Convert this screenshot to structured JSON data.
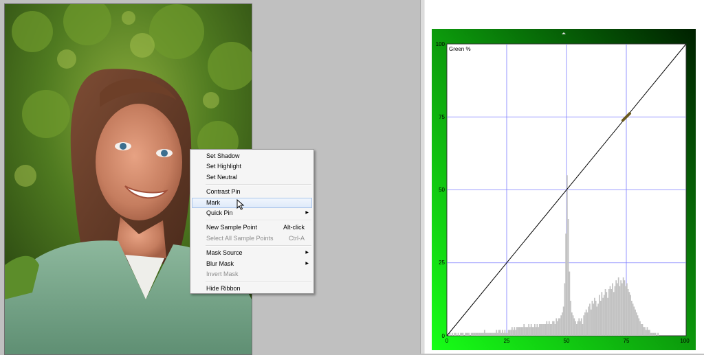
{
  "context_menu": {
    "items": [
      {
        "label": "Set Shadow"
      },
      {
        "label": "Set Highlight"
      },
      {
        "label": "Set Neutral"
      },
      {
        "label": "Contrast Pin"
      },
      {
        "label": "Mark",
        "highlighted": true
      },
      {
        "label": "Quick Pin",
        "submenu": true
      },
      {
        "label": "New Sample Point",
        "shortcut": "Alt-click"
      },
      {
        "label": "Select All Sample Points",
        "shortcut": "Ctrl-A",
        "disabled": true
      },
      {
        "label": "Mask Source",
        "submenu": true
      },
      {
        "label": "Blur Mask",
        "submenu": true
      },
      {
        "label": "Invert Mask",
        "disabled": true
      },
      {
        "label": "Hide Ribbon"
      }
    ]
  },
  "curve": {
    "channel_label": "Green %",
    "y_ticks": [
      "100",
      "75",
      "50",
      "25",
      "0"
    ],
    "x_ticks": [
      "0",
      "25",
      "50",
      "75",
      "100"
    ],
    "colors": {
      "frame": "#0aa20a",
      "grid": "#7b7bff",
      "histogram": "#c2c2c2",
      "curve": "#000000"
    }
  },
  "chart_data": {
    "type": "line",
    "title": "Green %",
    "xlabel": "",
    "ylabel": "",
    "xlim": [
      0,
      100
    ],
    "ylim": [
      0,
      100
    ],
    "grid": true,
    "series": [
      {
        "points": [
          [
            0,
            0
          ],
          [
            100,
            100
          ]
        ]
      }
    ],
    "control_points": [
      [
        75,
        75
      ]
    ],
    "histogram": {
      "x_start": 0,
      "x_step": 0.5,
      "values": [
        0,
        0,
        1,
        0,
        1,
        0,
        1,
        1,
        0,
        1,
        0,
        1,
        1,
        1,
        0,
        1,
        1,
        1,
        1,
        0,
        1,
        1,
        1,
        1,
        1,
        1,
        1,
        1,
        1,
        1,
        1,
        2,
        1,
        1,
        1,
        1,
        1,
        1,
        1,
        1,
        1,
        2,
        1,
        2,
        2,
        1,
        2,
        1,
        2,
        1,
        1,
        2,
        2,
        2,
        3,
        2,
        3,
        2,
        3,
        3,
        3,
        3,
        3,
        3,
        4,
        3,
        3,
        3,
        4,
        3,
        4,
        3,
        3,
        4,
        3,
        4,
        3,
        4,
        4,
        4,
        4,
        4,
        4,
        5,
        4,
        5,
        4,
        4,
        5,
        5,
        4,
        6,
        5,
        6,
        6,
        7,
        8,
        10,
        18,
        35,
        55,
        40,
        22,
        12,
        8,
        7,
        6,
        5,
        4,
        5,
        6,
        5,
        6,
        4,
        7,
        8,
        9,
        8,
        10,
        11,
        9,
        12,
        11,
        13,
        12,
        10,
        11,
        14,
        12,
        15,
        13,
        14,
        16,
        15,
        13,
        16,
        17,
        16,
        18,
        15,
        17,
        19,
        18,
        20,
        17,
        19,
        18,
        20,
        19,
        17,
        18,
        16,
        15,
        14,
        12,
        11,
        10,
        9,
        8,
        7,
        6,
        5,
        4,
        4,
        3,
        3,
        2,
        3,
        2,
        2,
        1,
        1,
        1,
        1,
        1,
        0,
        1,
        0,
        0,
        0,
        0,
        0,
        0,
        0,
        0,
        0,
        0,
        0,
        0,
        0,
        0,
        0,
        0,
        0,
        0,
        0,
        0
      ]
    }
  }
}
